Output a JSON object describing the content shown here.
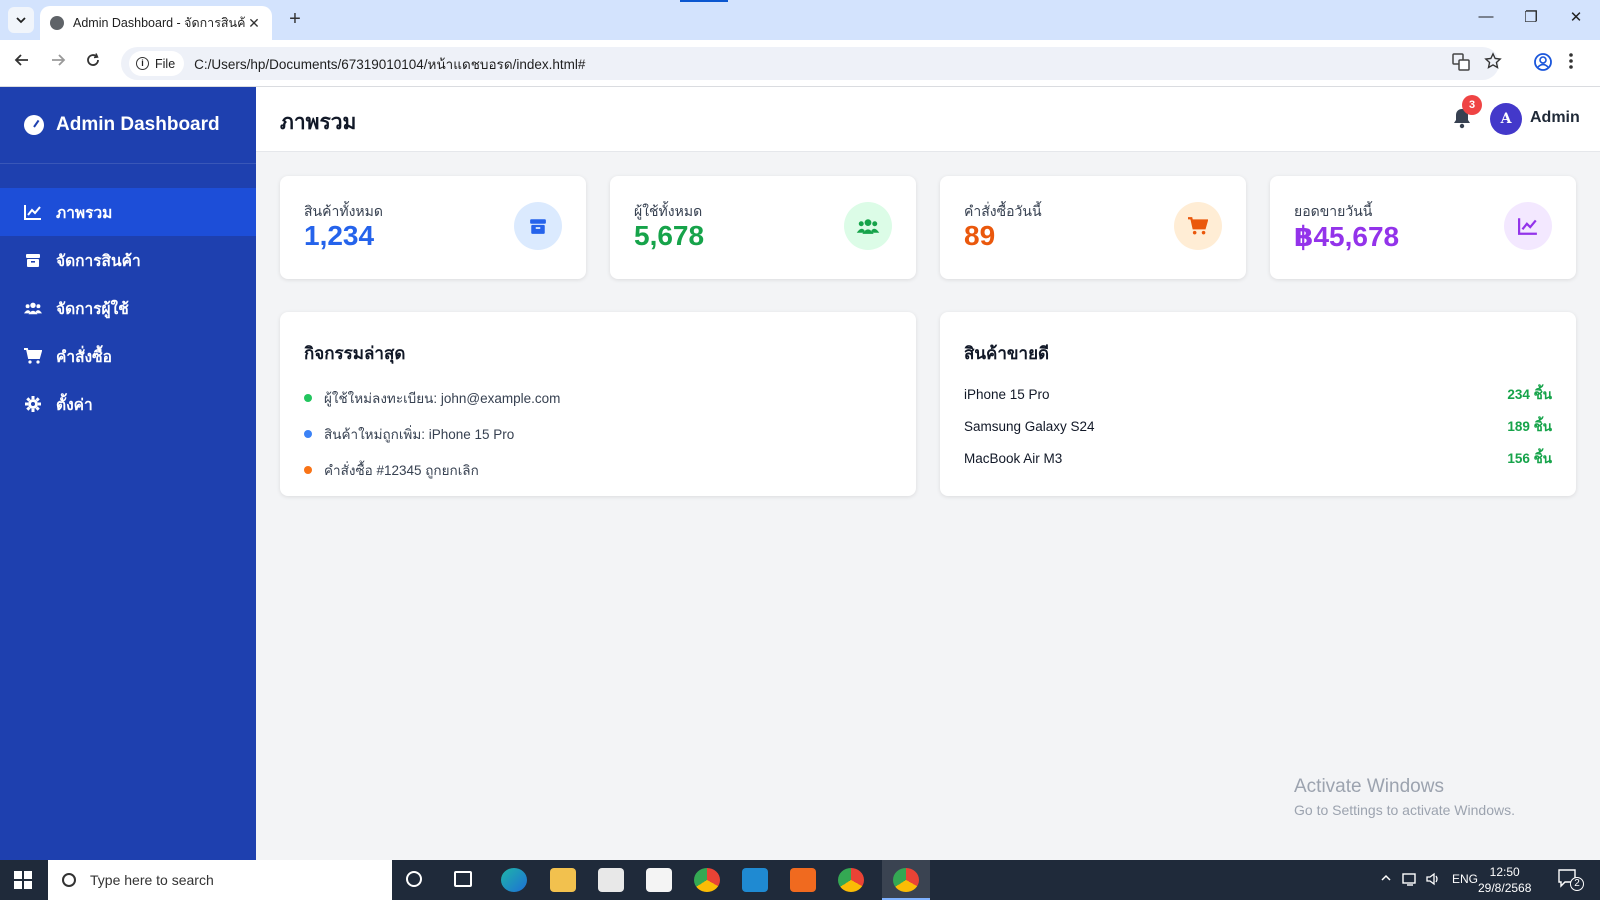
{
  "browser": {
    "tab_title": "Admin Dashboard - จัดการสินค้า",
    "tab_close": "✕",
    "new_tab": "+",
    "file_chip": "File",
    "url": "C:/Users/hp/Documents/67319010104/หน้าแดชบอรด/index.html#",
    "window_controls": [
      "—",
      "❐",
      "✕"
    ]
  },
  "sidebar": {
    "brand": "Admin Dashboard",
    "items": [
      {
        "label": "ภาพรวม",
        "icon": "chart-line-icon",
        "active": true
      },
      {
        "label": "จัดการสินค้า",
        "icon": "box-icon",
        "active": false
      },
      {
        "label": "จัดการผู้ใช้",
        "icon": "users-icon",
        "active": false
      },
      {
        "label": "คำสั่งซื้อ",
        "icon": "cart-icon",
        "active": false
      },
      {
        "label": "ตั้งค่า",
        "icon": "gear-icon",
        "active": false
      }
    ]
  },
  "header": {
    "title": "ภาพรวม",
    "notification_count": "3",
    "avatar_initial": "A",
    "user_name": "Admin"
  },
  "stats": [
    {
      "label": "สินค้าทั้งหมด",
      "value": "1,234",
      "color": "#2563eb",
      "icon": "box-icon"
    },
    {
      "label": "ผู้ใช้ทั้งหมด",
      "value": "5,678",
      "color": "#16a34a",
      "icon": "users-icon"
    },
    {
      "label": "คำสั่งซื้อวันนี้",
      "value": "89",
      "color": "#ea580c",
      "icon": "cart-icon"
    },
    {
      "label": "ยอดขายวันนี้",
      "value": "฿45,678",
      "color": "#9333ea",
      "icon": "chart-line-icon"
    }
  ],
  "activity": {
    "title": "กิจกรรมล่าสุด",
    "items": [
      {
        "text": "ผู้ใช้ใหม่ลงทะเบียน: john@example.com",
        "dot_color": "#22c55e"
      },
      {
        "text": "สินค้าใหม่ถูกเพิ่ม: iPhone 15 Pro",
        "dot_color": "#3b82f6"
      },
      {
        "text": "คำสั่งซื้อ #12345 ถูกยกเลิก",
        "dot_color": "#f97316"
      }
    ]
  },
  "best_sellers": {
    "title": "สินค้าขายดี",
    "items": [
      {
        "name": "iPhone 15 Pro",
        "qty": "234 ชิ้น"
      },
      {
        "name": "Samsung Galaxy S24",
        "qty": "189 ชิ้น"
      },
      {
        "name": "MacBook Air M3",
        "qty": "156 ชิ้น"
      }
    ]
  },
  "watermark": {
    "line1": "Activate Windows",
    "line2": "Go to Settings to activate Windows."
  },
  "taskbar": {
    "search_placeholder": "Type here to search",
    "language": "ENG",
    "time": "12:50",
    "date": "29/8/2568",
    "notification_count": "2"
  }
}
